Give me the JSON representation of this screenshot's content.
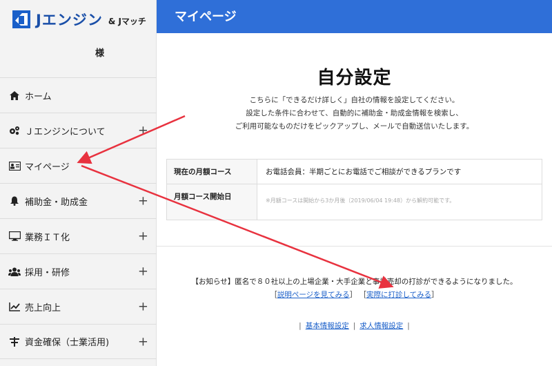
{
  "logo": {
    "main": "Jエンジン",
    "sub": "& Jマッチ"
  },
  "user": {
    "suffix": "様"
  },
  "sidebar": {
    "items": [
      {
        "label": "ホーム",
        "icon": "home-icon",
        "expandable": false
      },
      {
        "label": "Ｊエンジンについて",
        "icon": "gears-icon",
        "expandable": true
      },
      {
        "label": "マイページ",
        "icon": "id-card-icon",
        "expandable": false
      },
      {
        "label": "補助金・助成金",
        "icon": "bell-icon",
        "expandable": true
      },
      {
        "label": "業務ＩＴ化",
        "icon": "monitor-icon",
        "expandable": true
      },
      {
        "label": "採用・研修",
        "icon": "users-icon",
        "expandable": true
      },
      {
        "label": "売上向上",
        "icon": "chart-line-icon",
        "expandable": true
      },
      {
        "label": "資金確保（士業活用)",
        "icon": "money-icon",
        "expandable": true
      }
    ],
    "plus": "+"
  },
  "header": {
    "title": "マイページ"
  },
  "main": {
    "title": "自分設定",
    "description": [
      "こちらに「できるだけ詳しく」自社の情報を設定してください。",
      "設定した条件に合わせて、自動的に補助金・助成金情報を検索し、",
      "ご利用可能なものだけをピックアップし、メールで自動送信いたします。"
    ],
    "table": [
      {
        "header": "現在の月額コース",
        "value": "お電話会員：半期ごとにお電話でご相談ができるプランです",
        "note": ""
      },
      {
        "header": "月額コース開始日",
        "value": "",
        "note": "※月額コースは開始から3か月後（2019/06/04 19:48）から解約可能です。"
      }
    ],
    "notice": "【お知らせ】匿名で８０社以上の上場企業・大手企業と事業売却の打診ができるようになりました。",
    "notice_link_1": "説明ページを見てみる",
    "notice_link_2": "実際に打診してみる",
    "bracket_open": "［",
    "bracket_close": "］",
    "bottom_link_1": "基本情報設定",
    "bottom_link_2": "求人情報設定",
    "pipe": "|"
  },
  "colors": {
    "header_bg": "#2f6fd8",
    "link": "#1a5fc9",
    "arrow": "#e8323f",
    "logo": "#1a4fa8"
  }
}
